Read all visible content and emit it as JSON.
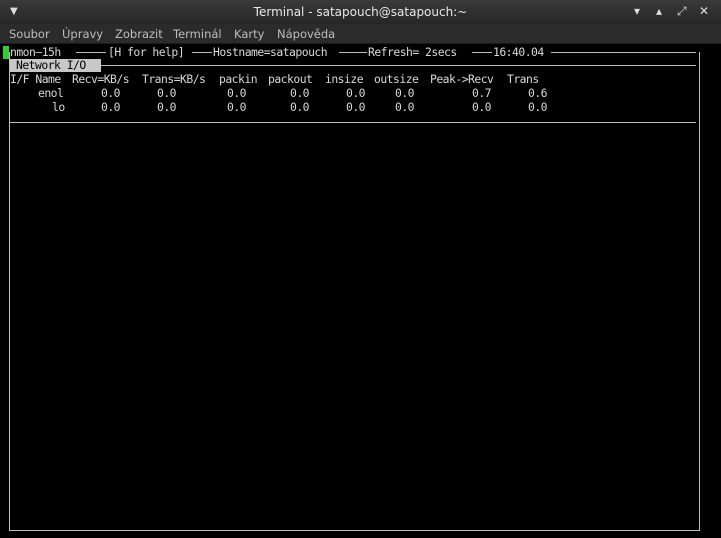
{
  "window": {
    "title": "Terminal - satapouch@satapouch:~",
    "menu_arrow": "▼",
    "minimize": "▾",
    "restore": "▴",
    "maximize": "⤢",
    "close": "✕"
  },
  "menubar": {
    "items": [
      "Soubor",
      "Úpravy",
      "Zobrazit",
      "Terminál",
      "Karty",
      "Nápověda"
    ]
  },
  "nmon": {
    "header": {
      "program": "nmon—15h",
      "help": "[H for help]",
      "hostname": "Hostname=satapouch",
      "refresh": "Refresh= 2secs",
      "time": "16:40.04"
    },
    "section_title": "Network I/O",
    "columns": [
      "I/F Name",
      "Recv=KB/s",
      "Trans=KB/s",
      "packin",
      "packout",
      "insize",
      "outsize",
      "Peak->Recv",
      "Trans"
    ],
    "rows": [
      {
        "name": "enol",
        "recv": "0.0",
        "trans": "0.0",
        "packin": "0.0",
        "packout": "0.0",
        "insize": "0.0",
        "outsize": "0.0",
        "peak_recv": "0.7",
        "peak_trans": "0.6"
      },
      {
        "name": "lo",
        "recv": "0.0",
        "trans": "0.0",
        "packin": "0.0",
        "packout": "0.0",
        "insize": "0.0",
        "outsize": "0.0",
        "peak_recv": "0.0",
        "peak_trans": "0.0"
      }
    ]
  }
}
